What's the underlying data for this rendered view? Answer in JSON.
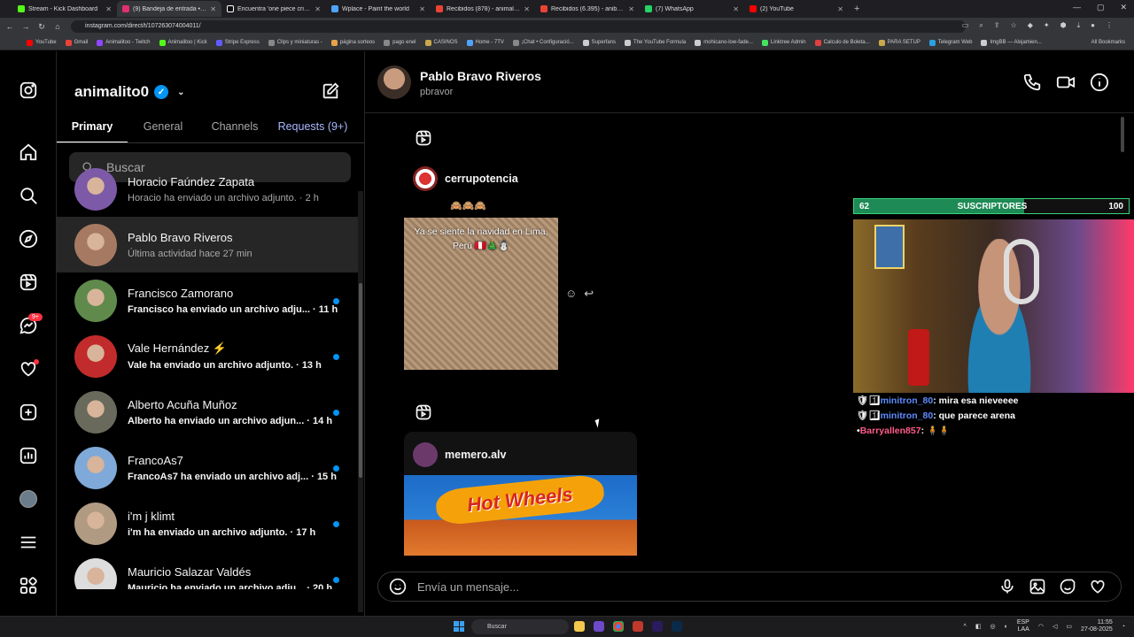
{
  "browser": {
    "tabs": [
      {
        "title": "Stream - Kick Dashboard",
        "color": "#53fc18",
        "active": false
      },
      {
        "title": "(9) Bandeja de entrada • Chats",
        "color": "#e1306c",
        "active": true
      },
      {
        "title": "Encuentra 'one piece cringe' en",
        "color": "#111111",
        "active": false
      },
      {
        "title": "Wplace - Paint the world",
        "color": "#4fa3ff",
        "active": false
      },
      {
        "title": "Recibidos (878) - animalitoo.s",
        "color": "#ea4335",
        "active": false
      },
      {
        "title": "Recibidos (6.395) - anibal.nano",
        "color": "#ea4335",
        "active": false
      },
      {
        "title": "(7) WhatsApp",
        "color": "#25d366",
        "active": false
      },
      {
        "title": "(2) YouTube",
        "color": "#ff0000",
        "active": false
      }
    ],
    "url": "instagram.com/direct/t/107263074004011/",
    "bookmarks": [
      {
        "label": "YouTube",
        "color": "#ff0000"
      },
      {
        "label": "Gmail",
        "color": "#ea4335"
      },
      {
        "label": "Animalitoo - Twitch",
        "color": "#9146ff"
      },
      {
        "label": "Animalitoo | Kick",
        "color": "#53fc18"
      },
      {
        "label": "Stripe Express",
        "color": "#635bff"
      },
      {
        "label": "Clips y miniaturas -",
        "color": "#888888"
      },
      {
        "label": "página sorteos",
        "color": "#e7a24a"
      },
      {
        "label": "pago enel",
        "color": "#888888"
      },
      {
        "label": "CASINOS",
        "color": "#caa84a"
      },
      {
        "label": "Home - 7TV",
        "color": "#4fa3ff"
      },
      {
        "label": "¡Chat • Configuració...",
        "color": "#888888"
      },
      {
        "label": "Superfans",
        "color": "#cccccc"
      },
      {
        "label": "The YouTube Formula",
        "color": "#cccccc"
      },
      {
        "label": "mohicano-low-fade...",
        "color": "#cccccc"
      },
      {
        "label": "Linktree Admin",
        "color": "#43e55e"
      },
      {
        "label": "Calculo de Boleta...",
        "color": "#e04040"
      },
      {
        "label": "PARA SETUP",
        "color": "#caa84a"
      },
      {
        "label": "Telegram Web",
        "color": "#2aa1e0"
      },
      {
        "label": "ImgBB — Alojamien...",
        "color": "#cccccc"
      }
    ],
    "all_bookmarks": "All Bookmarks"
  },
  "sidebar": {
    "notification_badge": "9+"
  },
  "inbox": {
    "username": "animalito0",
    "tabs": [
      "Primary",
      "General",
      "Channels",
      "Requests (9+)"
    ],
    "search_placeholder": "Buscar",
    "threads": [
      {
        "name": "Horacio Faúndez Zapata",
        "preview": "Horacio ha enviado un archivo adjunto. · 2 h",
        "unread": false,
        "selected": false,
        "avatar": "#7c5aa8"
      },
      {
        "name": "Pablo Bravo Riveros",
        "preview": "Última actividad hace 27 min",
        "unread": false,
        "selected": true,
        "avatar": "#a67a62"
      },
      {
        "name": "Francisco Zamorano",
        "preview": "Francisco ha enviado un archivo adju... · 11 h",
        "unread": true,
        "selected": false,
        "avatar": "#5f8a4c"
      },
      {
        "name": "Vale Hernández ⚡",
        "preview": "Vale ha enviado un archivo adjunto. · 13 h",
        "unread": true,
        "selected": false,
        "avatar": "#c22b2b"
      },
      {
        "name": "Alberto Acuña Muñoz",
        "preview": "Alberto ha enviado un archivo adjun... · 14 h",
        "unread": true,
        "selected": false,
        "avatar": "#6a6a5c"
      },
      {
        "name": "FrancoAs7",
        "preview": "FrancoAs7 ha enviado un archivo adj... · 15 h",
        "unread": true,
        "selected": false,
        "avatar": "#7fa9d8"
      },
      {
        "name": "i'm j klimt",
        "preview": "i'm ha enviado un archivo adjunto. · 17 h",
        "unread": true,
        "selected": false,
        "avatar": "#b09a82"
      },
      {
        "name": "Mauricio Salazar Valdés",
        "preview": "Mauricio ha enviado un archivo adju... · 20 h",
        "unread": true,
        "selected": false,
        "avatar": "#dddddd"
      }
    ]
  },
  "chat": {
    "name": "Pablo Bravo Riveros",
    "username": "pbravor",
    "messages": [
      {
        "sender": "cerrupotencia",
        "emojis": "🙈🙈🙈",
        "caption": "Ya se siente la navidad en Lima, Perú 🇵🇪🎄☃️"
      },
      {
        "sender": "memero.alv",
        "image_text": "Hot Wheels"
      }
    ],
    "composer_placeholder": "Envía un mensaje..."
  },
  "stream_overlay": {
    "goal_current": "62",
    "goal_label": "SUSCRIPTORES",
    "goal_target": "100",
    "goal_progress": 0.62,
    "chat": [
      {
        "user": "minitron_80",
        "message": "mira esa nieveeee",
        "badges": "🛡1⃣"
      },
      {
        "user": "minitron_80",
        "message": "que parece arena",
        "badges": "🛡1⃣"
      },
      {
        "user": "Barryallen857",
        "message": "🧍🧍",
        "badges": "•"
      }
    ]
  },
  "taskbar": {
    "search": "Buscar",
    "lang": "ESP",
    "lang2": "LAA",
    "time": "11:55",
    "date": "27-08-2025"
  }
}
